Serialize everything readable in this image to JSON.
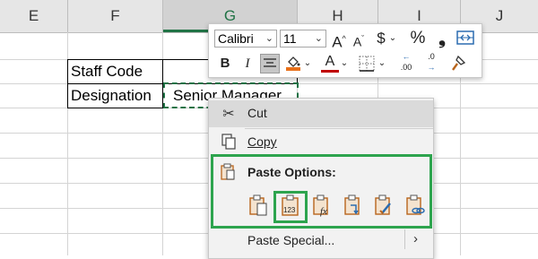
{
  "columns": [
    {
      "label": "E",
      "selected": false
    },
    {
      "label": "F",
      "selected": false
    },
    {
      "label": "G",
      "selected": true
    },
    {
      "label": "H",
      "selected": false
    },
    {
      "label": "I",
      "selected": false
    },
    {
      "label": "J",
      "selected": false
    }
  ],
  "cells": {
    "staff_code_label": "Staff Code",
    "designation_label": "Designation",
    "designation_value": "Senior Manager"
  },
  "minibar": {
    "font_name": "Calibri",
    "font_size": "11",
    "grow_font": "A",
    "shrink_font": "A",
    "currency": "$",
    "percent": "%",
    "comma": "❟",
    "bold": "B",
    "italic": "I",
    "font_color": "A",
    "dec_increase_digits": ".00",
    "dec_decrease_digits": ".0"
  },
  "menu": {
    "cut": "Cut",
    "copy": "Copy",
    "paste_options": "Paste Options:",
    "paste_special": "Paste Special...",
    "paste_values_digits": "123"
  },
  "colors": {
    "excel_green": "#217346",
    "highlight_green": "#2da44e",
    "fill_orange": "#e8701a",
    "clip_orange": "#b8651d"
  }
}
